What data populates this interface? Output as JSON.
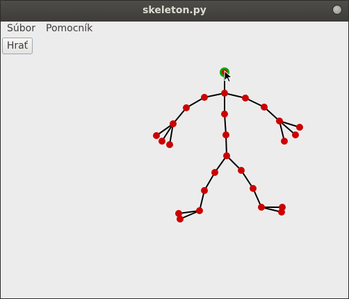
{
  "window": {
    "title": "skeleton.py"
  },
  "menubar": {
    "items": [
      "Súbor",
      "Pomocník"
    ]
  },
  "toolbar": {
    "play_label": "Hrať"
  },
  "colors": {
    "joint": "#cc0000",
    "selected_joint": "#00aa00",
    "bone": "#000000"
  },
  "icons": {
    "cursor": "mouse-pointer-icon",
    "close": "window-button-icon"
  }
}
